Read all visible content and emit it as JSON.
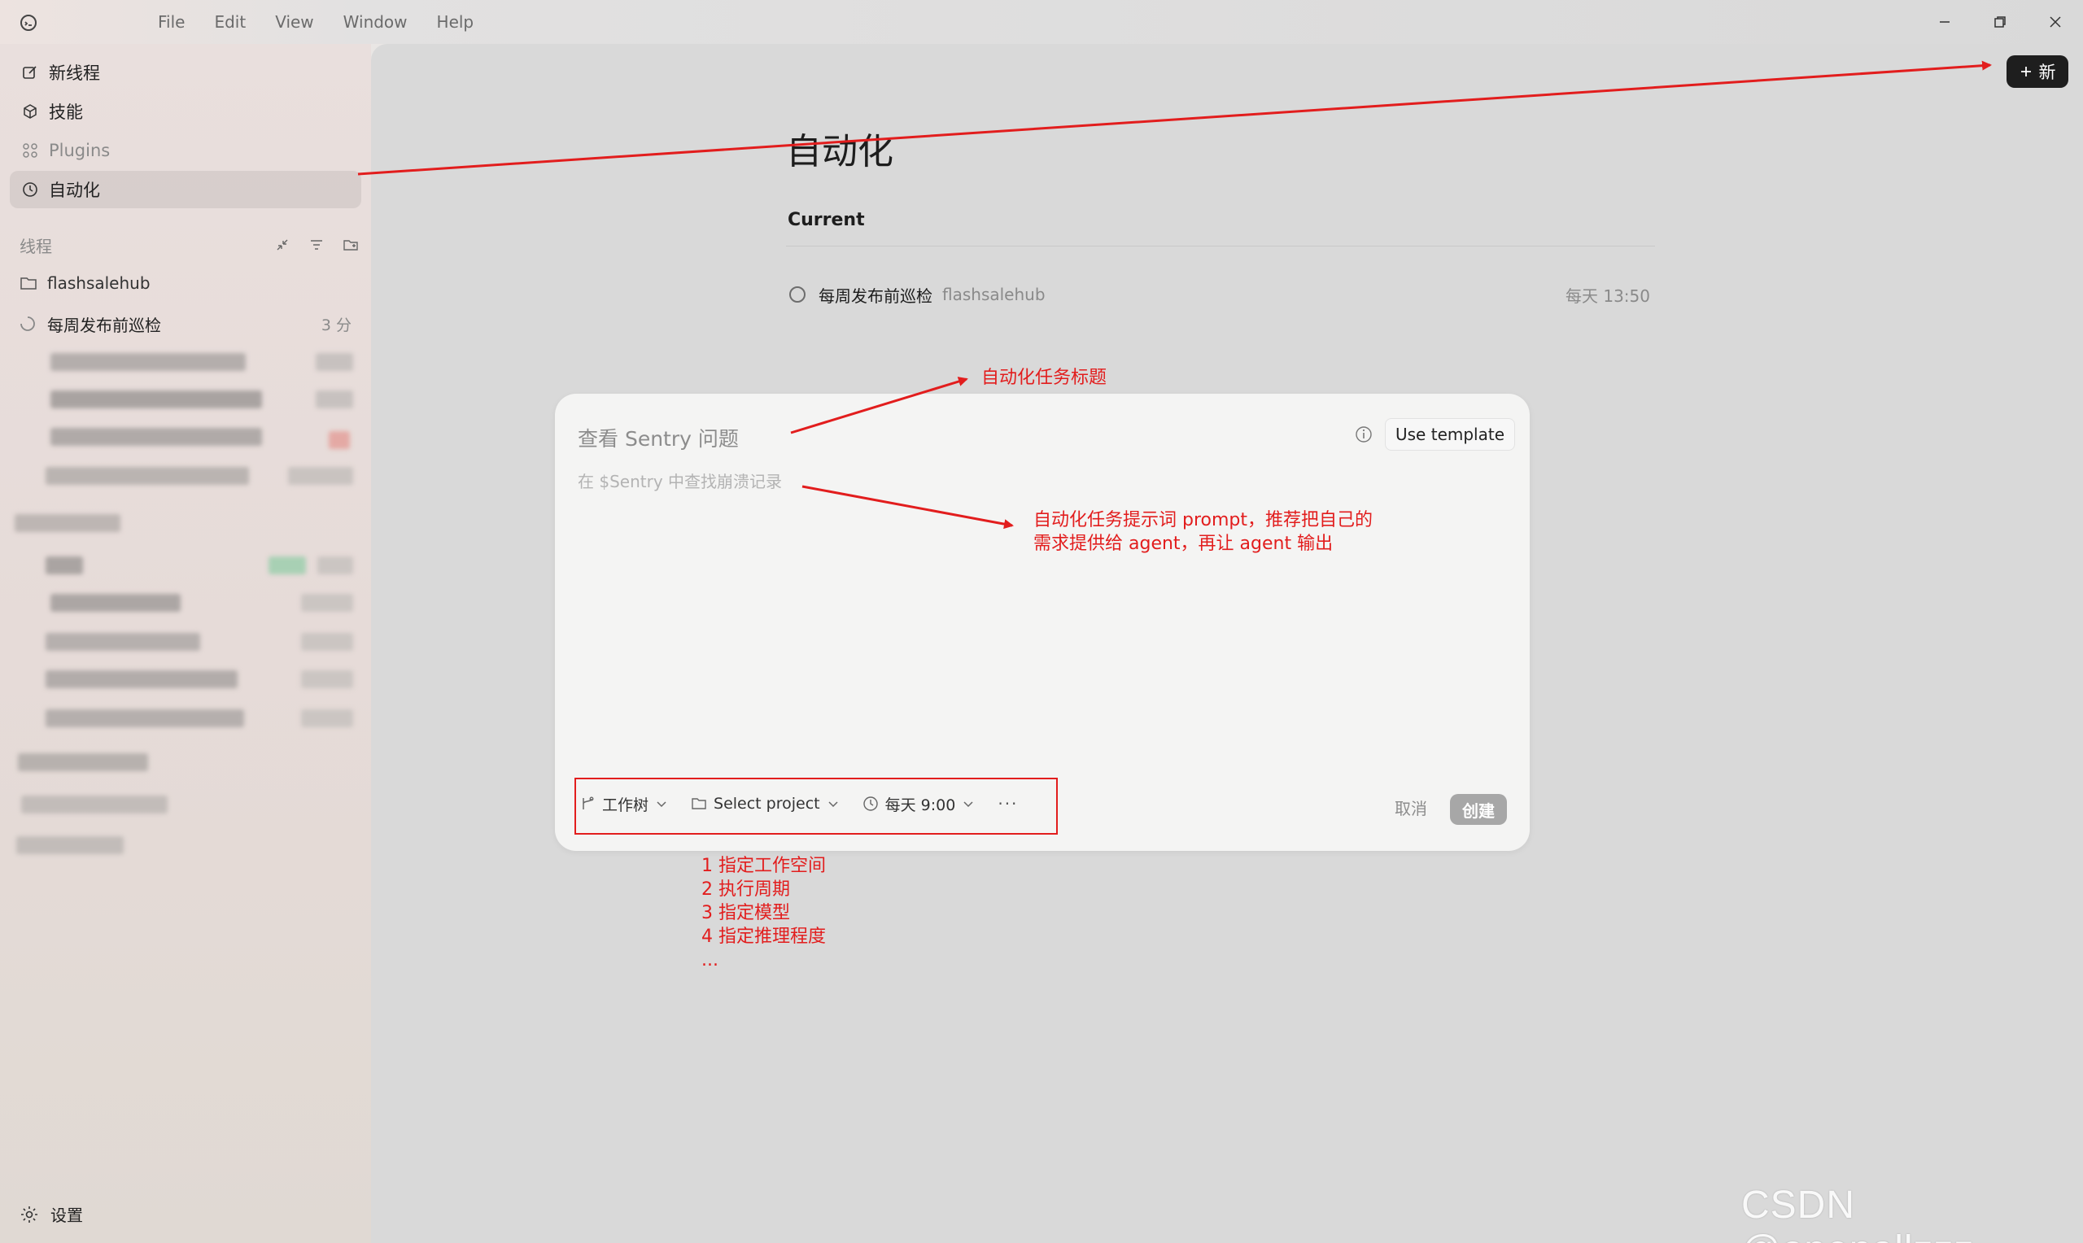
{
  "menu": [
    "File",
    "Edit",
    "View",
    "Window",
    "Help"
  ],
  "sidebar": {
    "nav": [
      {
        "label": "新线程",
        "icon": "edit-icon"
      },
      {
        "label": "技能",
        "icon": "cube-icon"
      },
      {
        "label": "Plugins",
        "icon": "grid-icon"
      },
      {
        "label": "自动化",
        "icon": "clock-icon",
        "active": true
      }
    ],
    "threads_label": "线程",
    "folder": "flashsalehub",
    "thread": {
      "name": "每周发布前巡检",
      "time": "3 分"
    },
    "settings": "设置"
  },
  "header": {
    "new_button": "新"
  },
  "main": {
    "title": "自动化",
    "section": "Current",
    "automation": {
      "name": "每周发布前巡检",
      "project": "flashsalehub",
      "schedule": "每天 13:50"
    }
  },
  "modal": {
    "title_placeholder": "查看 Sentry 问题",
    "prompt_placeholder": "在 $Sentry 中查找崩溃记录",
    "use_template": "Use template",
    "options": {
      "worktree": "工作树",
      "project": "Select project",
      "schedule": "每天 9:00",
      "more": "···"
    },
    "cancel": "取消",
    "create": "创建"
  },
  "annotations": {
    "title_note": "自动化任务标题",
    "prompt_note_1": "自动化任务提示词 prompt，推荐把自己的",
    "prompt_note_2": "需求提供给 agent，再让 agent 输出",
    "options_notes": [
      "1 指定工作空间",
      "2 执行周期",
      "3 指定模型",
      "4 指定推理程度",
      "..."
    ]
  },
  "watermark": "CSDN @openallzzz",
  "colors": {
    "annotation_red": "#e21d1d",
    "new_button_bg": "#1e1e1e",
    "create_button_bg": "#a7a7a7"
  }
}
